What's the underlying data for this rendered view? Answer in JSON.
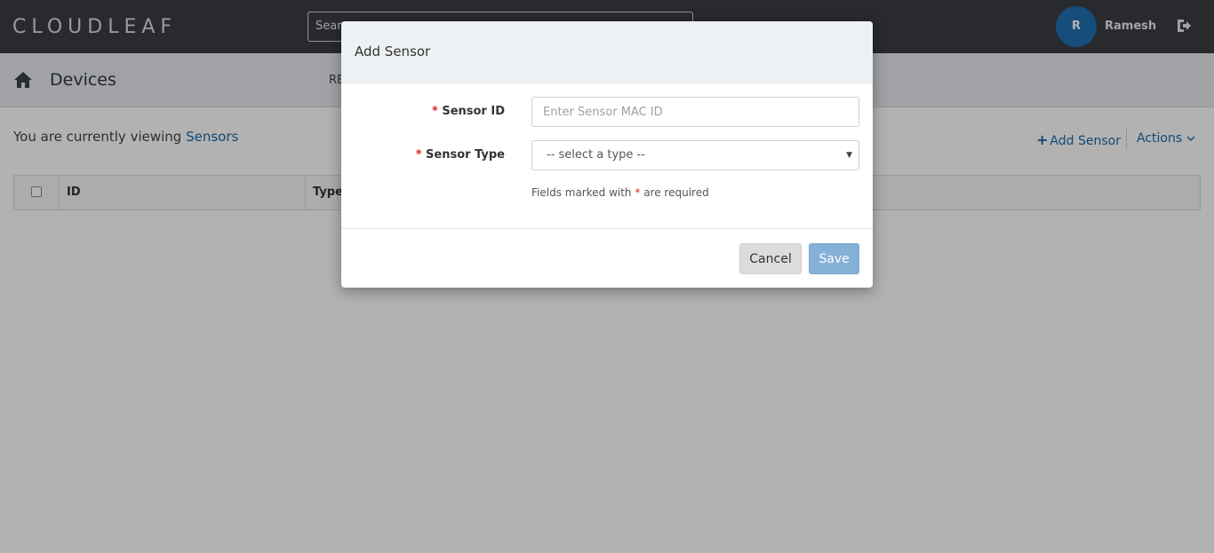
{
  "header": {
    "logo_text": "CLOUDLEAF",
    "search_text": "Searc",
    "user_initial": "R",
    "user_name": "Ramesh",
    "logout_icon": "sign-out-icon"
  },
  "subheader": {
    "home_icon": "home-icon",
    "title": "Devices",
    "nav_fragment": "RE"
  },
  "content": {
    "viewing_prefix": "You are currently viewing",
    "viewing_target": "Sensors",
    "add_sensor_label": "Add Sensor",
    "actions_label": "Actions",
    "table_columns": [
      "ID",
      "Type"
    ]
  },
  "modal": {
    "title": "Add Sensor",
    "required_marker": "*",
    "sensor_id_label": "Sensor ID",
    "sensor_id_placeholder": "Enter Sensor MAC ID",
    "sensor_type_label": "Sensor Type",
    "sensor_type_selected": "-- select a type --",
    "help_prefix": "Fields marked with",
    "help_suffix": "are required",
    "cancel_label": "Cancel",
    "save_label": "Save"
  },
  "colors": {
    "topbar": "#3b3d42",
    "accent": "#1a6aa8",
    "avatar": "#1f6fb0",
    "required": "#d9272e",
    "save_button": "#85b0d8"
  }
}
